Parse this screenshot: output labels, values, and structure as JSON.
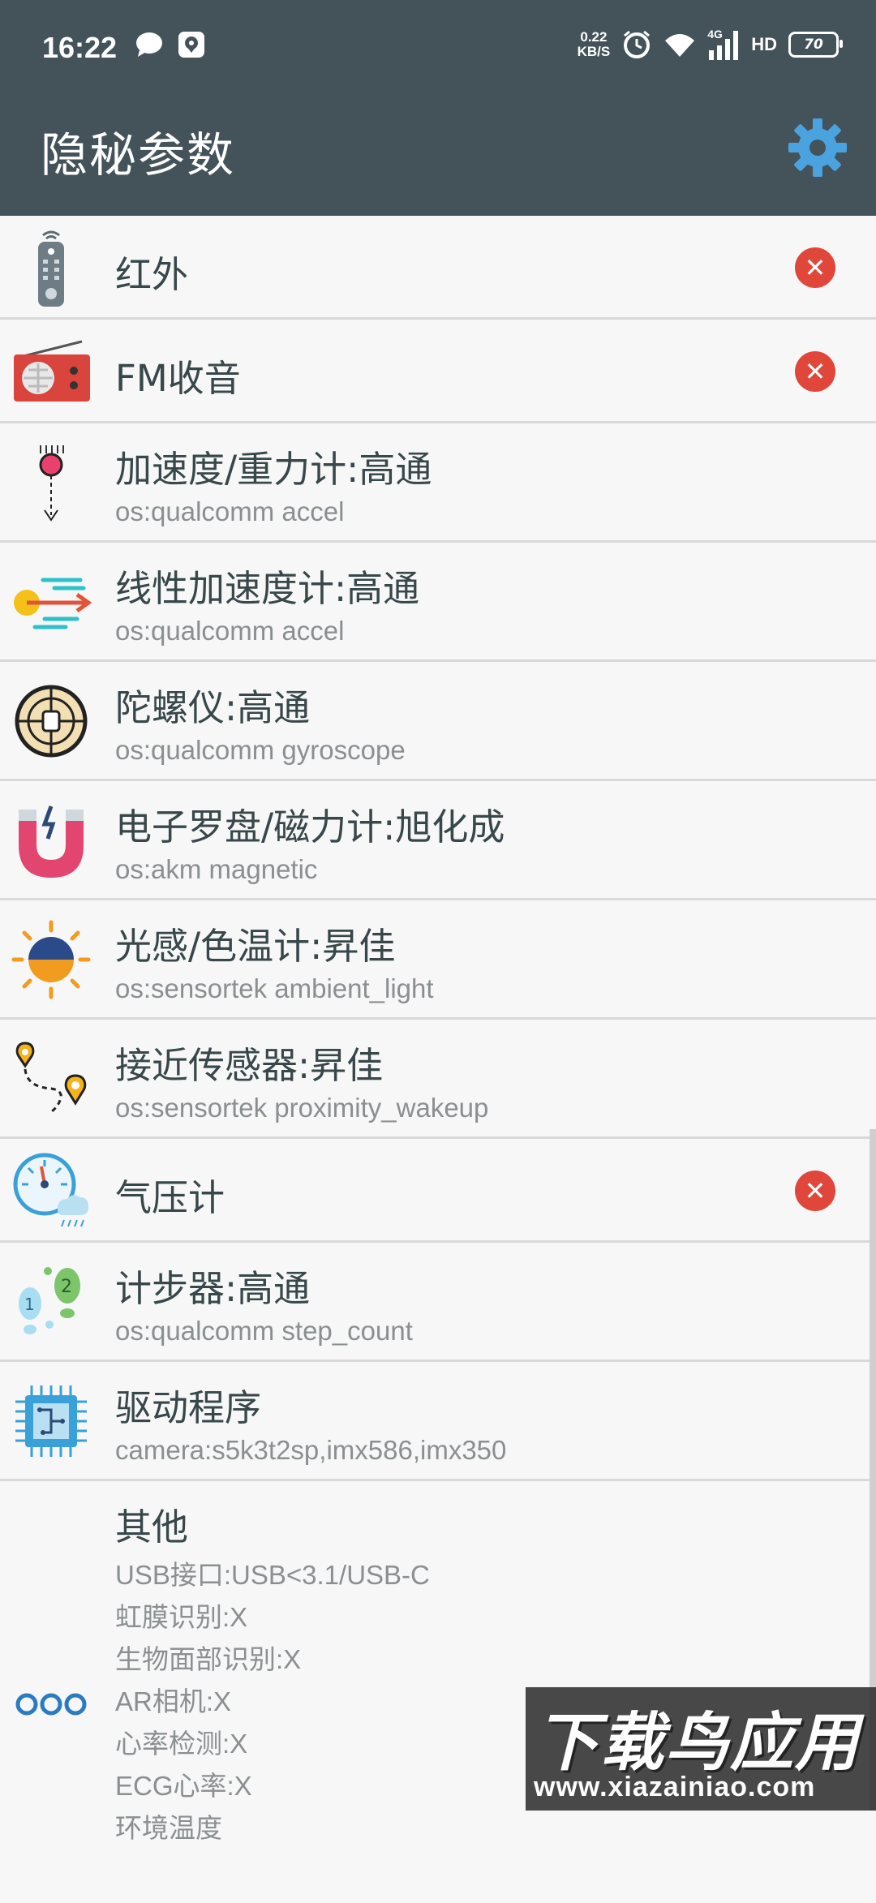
{
  "status_bar": {
    "time": "16:22",
    "net_speed_value": "0.22",
    "net_speed_unit": "KB/S",
    "signal_label": "4G",
    "hd_label": "HD",
    "battery_level": "70"
  },
  "header": {
    "title": "隐秘参数",
    "settings_icon": "gear-icon"
  },
  "items": [
    {
      "label": "红外",
      "sub": "",
      "unsupported": true,
      "icon": "remote-control-icon"
    },
    {
      "label": "FM收音",
      "sub": "",
      "unsupported": true,
      "icon": "radio-icon"
    },
    {
      "label": "加速度/重力计:高通",
      "sub": "os:qualcomm accel",
      "unsupported": false,
      "icon": "accelerometer-icon"
    },
    {
      "label": "线性加速度计:高通",
      "sub": "os:qualcomm accel",
      "unsupported": false,
      "icon": "linear-acceleration-icon"
    },
    {
      "label": "陀螺仪:高通",
      "sub": "os:qualcomm gyroscope",
      "unsupported": false,
      "icon": "gyroscope-icon"
    },
    {
      "label": "电子罗盘/磁力计:旭化成",
      "sub": "os:akm magnetic",
      "unsupported": false,
      "icon": "magnet-icon"
    },
    {
      "label": "光感/色温计:昇佳",
      "sub": "os:sensortek ambient_light",
      "unsupported": false,
      "icon": "light-sensor-icon"
    },
    {
      "label": "接近传感器:昇佳",
      "sub": "os:sensortek proximity_wakeup",
      "unsupported": false,
      "icon": "proximity-icon"
    },
    {
      "label": "气压计",
      "sub": "",
      "unsupported": true,
      "icon": "barometer-icon"
    },
    {
      "label": "计步器:高通",
      "sub": "os:qualcomm step_count",
      "unsupported": false,
      "icon": "footsteps-icon"
    },
    {
      "label": "驱动程序",
      "sub": "camera:s5k3t2sp,imx586,imx350",
      "unsupported": false,
      "icon": "chip-icon"
    }
  ],
  "other": {
    "label": "其他",
    "icon": "more-dots-icon",
    "lines": [
      "USB接口:USB<3.1/USB-C",
      "虹膜识别:X",
      "生物面部识别:X",
      "AR相机:X",
      "心率检测:X",
      "ECG心率:X",
      "环境温度"
    ]
  },
  "badge_symbol": "✕",
  "watermark": {
    "text": "下载鸟应用",
    "url": "www.xiazainiao.com"
  },
  "colors": {
    "appbar": "#445259",
    "badge_red": "#e0463a",
    "text_primary": "#37474a",
    "text_secondary": "#8a8f92"
  }
}
